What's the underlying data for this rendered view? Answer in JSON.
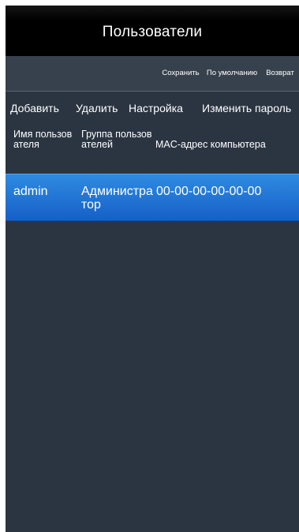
{
  "title": "Пользователи",
  "toolbar": {
    "save": "Сохранить",
    "default": "По умолчанию",
    "back": "Возврат"
  },
  "actions": {
    "add": "Добавить",
    "delete": "Удалить",
    "settings": "Настройка",
    "change_password": "Изменить пароль"
  },
  "columns": {
    "user_name": "Имя пользователя",
    "user_group": "Группа пользователей",
    "mac": "MAC-адрес компьютера"
  },
  "rows": [
    {
      "name": "admin",
      "group": "Администратор",
      "mac": "00-00-00-00-00-00"
    }
  ],
  "colors": {
    "background": "#2b3542",
    "titlebar": "#000000",
    "selected_row": "#1f74d6"
  }
}
